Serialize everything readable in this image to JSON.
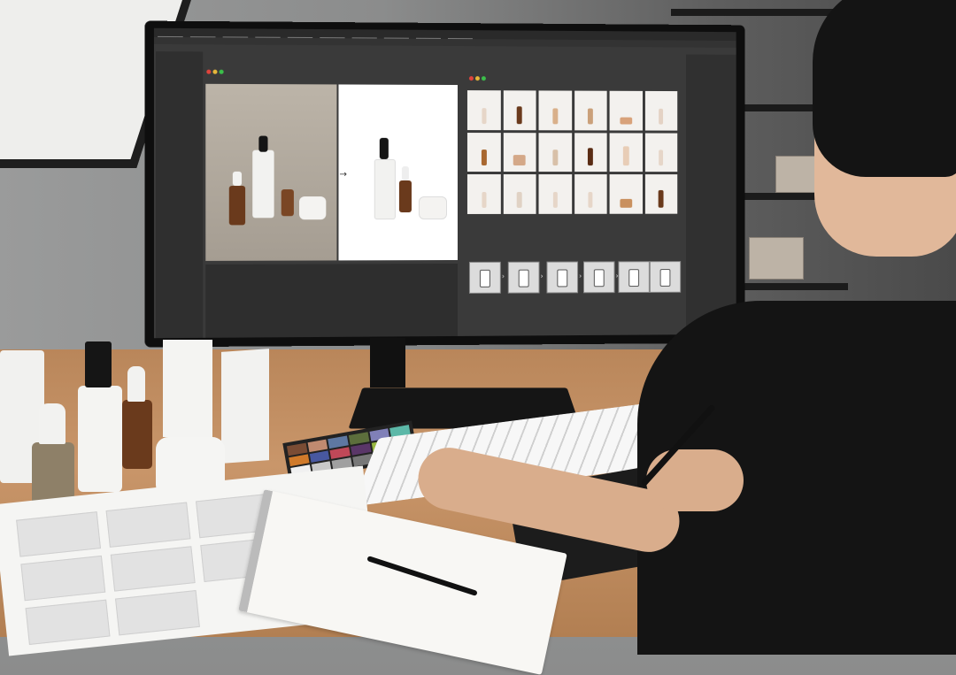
{
  "scene": {
    "description_tags": [
      "workspace",
      "photo-editing",
      "product-photography"
    ]
  },
  "screen": {
    "window_dot_colors": [
      "#e0443c",
      "#e6b73a",
      "#3bbf4a"
    ],
    "before_after_arrow": "→",
    "thumbnail_rows": 3,
    "thumbnail_cols": 6,
    "workflow_arrow": "›"
  },
  "colors": {
    "amber_bottle": "#6a3a1c",
    "white_bottle": "#f2f2f0",
    "cap_black": "#151515"
  }
}
